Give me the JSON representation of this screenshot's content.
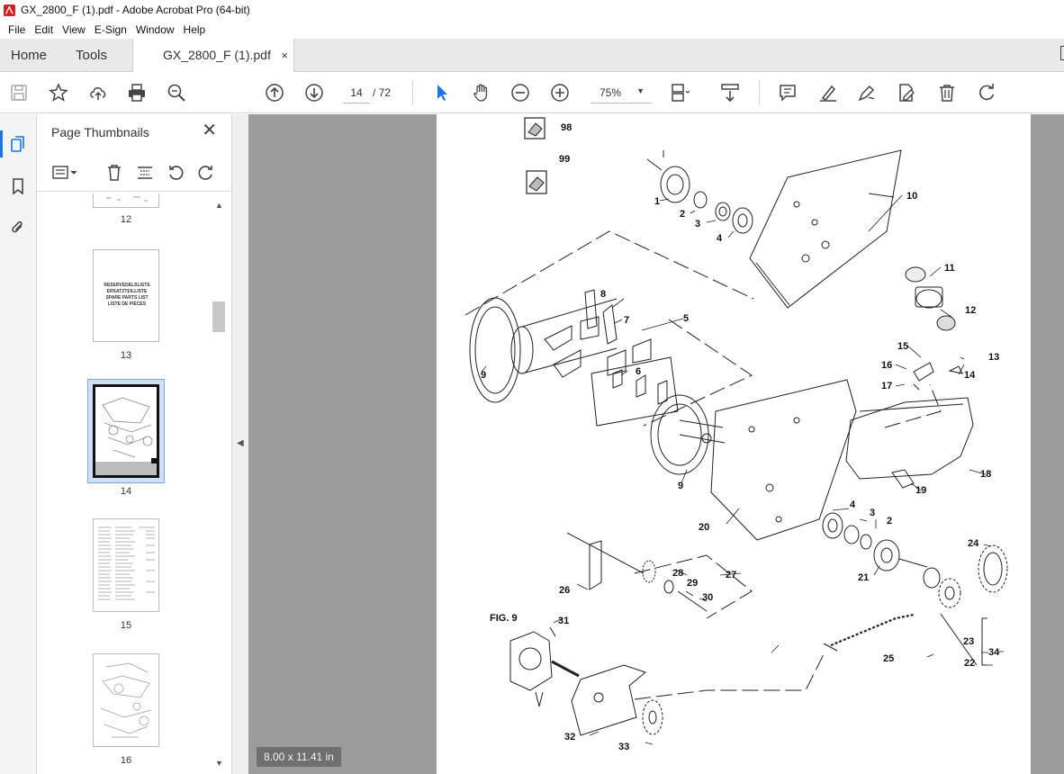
{
  "window": {
    "title": "GX_2800_F (1).pdf - Adobe Acrobat Pro (64-bit)"
  },
  "menu": {
    "items": [
      "File",
      "Edit",
      "View",
      "E-Sign",
      "Window",
      "Help"
    ]
  },
  "tabs": {
    "home": "Home",
    "tools": "Tools",
    "document": "GX_2800_F (1).pdf",
    "close": "×"
  },
  "toolbar": {
    "page_current": "14",
    "page_total": "/ 72",
    "zoom": "75%",
    "icons": [
      "save-icon",
      "star-icon",
      "cloud-upload-icon",
      "print-icon",
      "search-zoom-icon",
      "page-up-icon",
      "page-down-icon",
      "select-cursor-icon",
      "hand-icon",
      "zoom-out-icon",
      "zoom-in-icon",
      "fit-page-icon",
      "scroll-mode-icon",
      "comment-icon",
      "highlight-icon",
      "sign-icon",
      "edit-pdf-icon",
      "delete-icon",
      "redo-icon"
    ]
  },
  "thumbnail_panel": {
    "title": "Page Thumbnails",
    "close": "✕",
    "thumbnails": [
      {
        "page": "12"
      },
      {
        "page": "13",
        "text_lines": [
          "RESERVEDELSLISTE",
          "ERSATZTEILLISTE",
          "SPARE PARTS LIST",
          "LISTE DE PIÈCES"
        ]
      },
      {
        "page": "14",
        "selected": true
      },
      {
        "page": "15"
      },
      {
        "page": "16"
      }
    ]
  },
  "document": {
    "page_size": "8.00 x 11.41 in",
    "figure_label": "FIG. 9",
    "callouts": [
      "98",
      "99",
      "1",
      "2",
      "3",
      "4",
      "10",
      "11",
      "12",
      "13",
      "14",
      "15",
      "16",
      "17",
      "5",
      "6",
      "7",
      "8",
      "9",
      "9",
      "18",
      "19",
      "20",
      "4",
      "3",
      "2",
      "24",
      "21",
      "26",
      "27",
      "28",
      "29",
      "30",
      "23",
      "34",
      "22",
      "25",
      "31",
      "32",
      "33"
    ]
  }
}
